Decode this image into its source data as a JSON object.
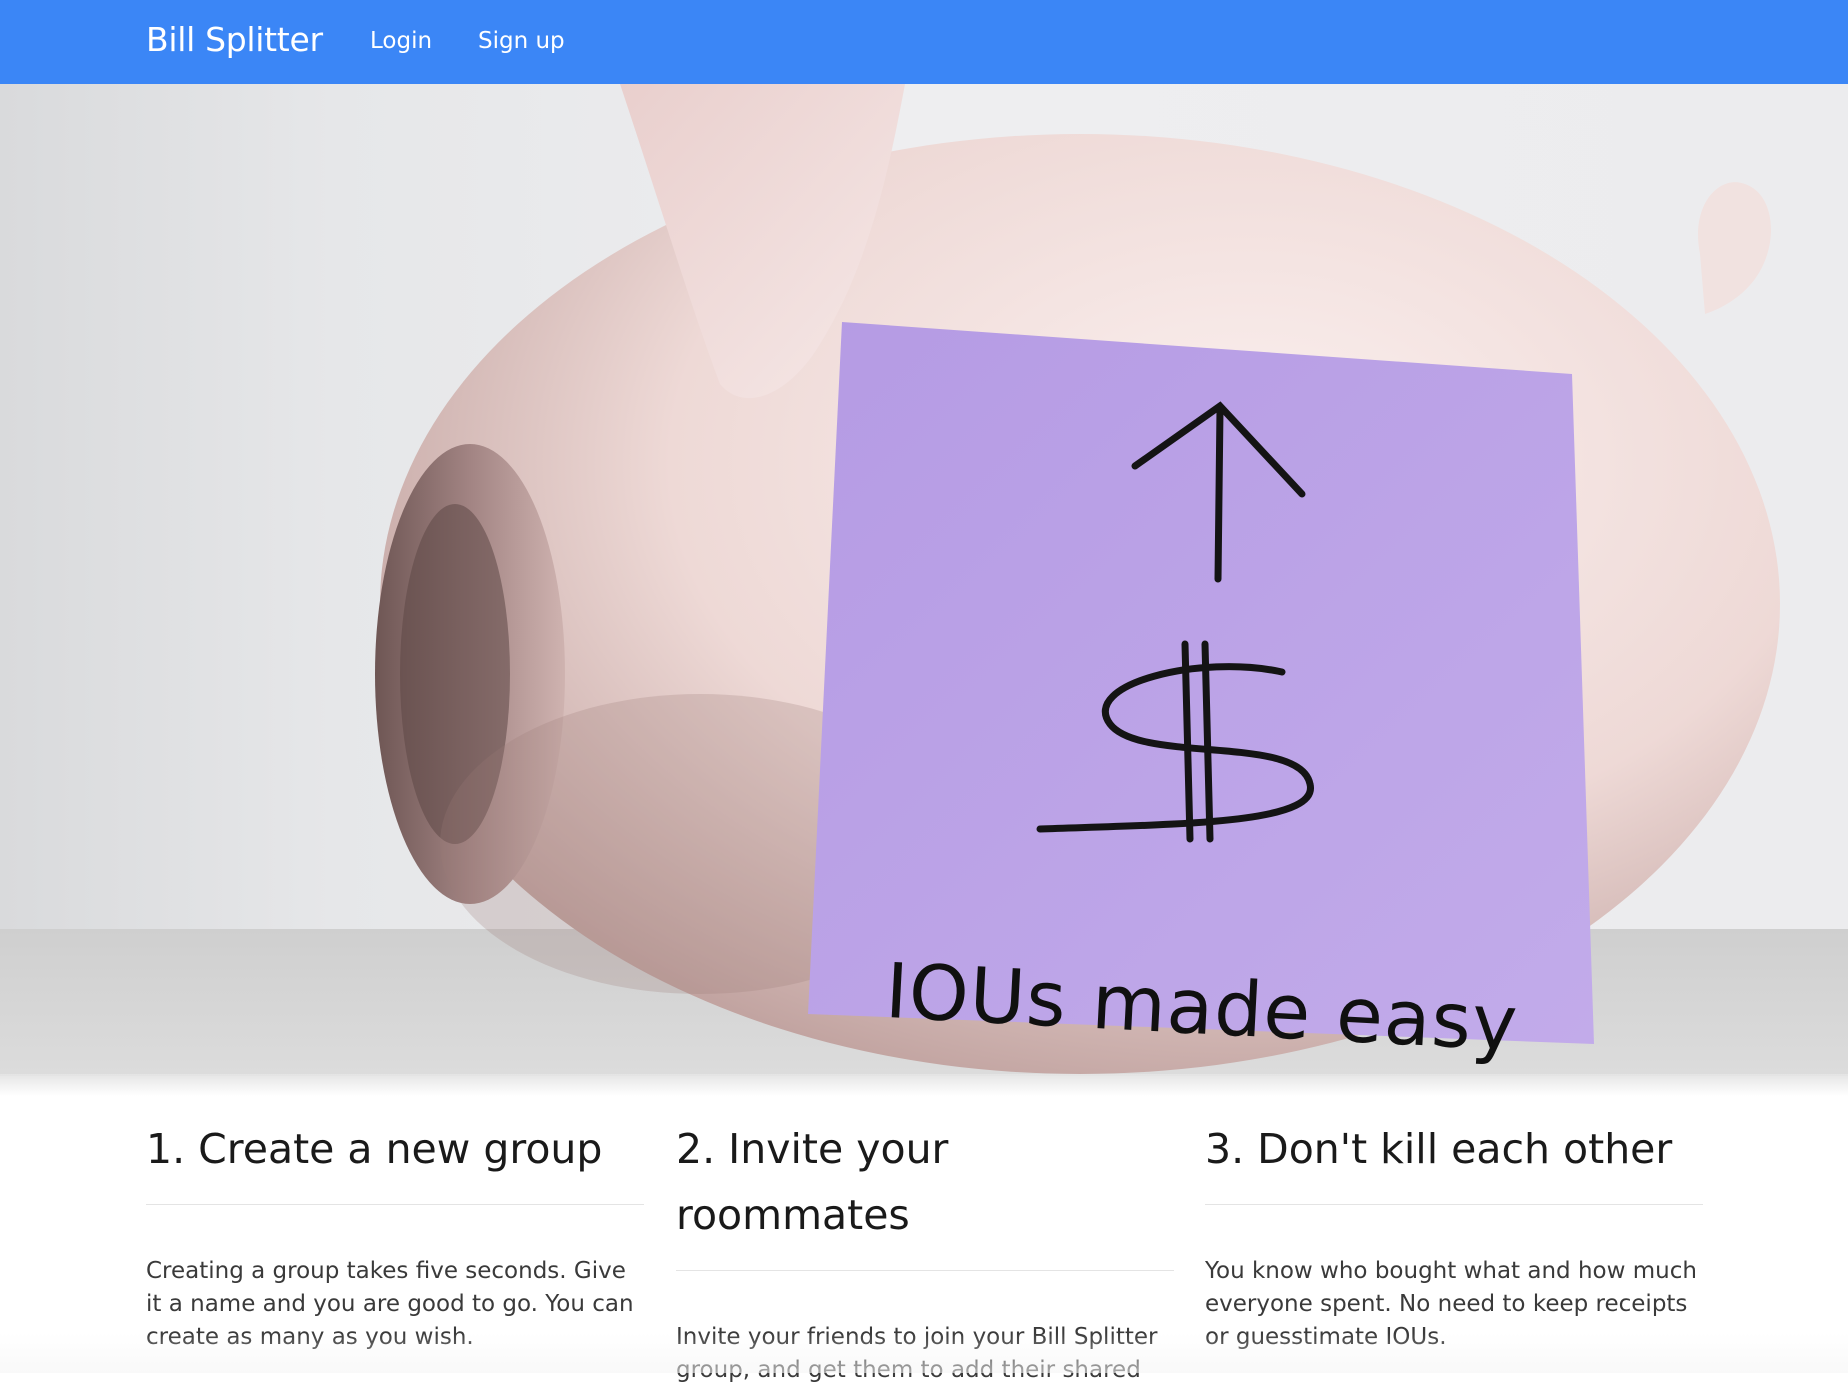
{
  "navbar": {
    "brand": "Bill Splitter",
    "links": [
      {
        "label": "Login"
      },
      {
        "label": "Sign up"
      }
    ],
    "color": "#3b86f6"
  },
  "hero": {
    "tagline": "IOUs made easy",
    "note_color": "#b79ae6",
    "pig_color": "#f2e1de"
  },
  "features": [
    {
      "title": "1. Create a new group",
      "text": "Creating a group takes five seconds. Give it a name and you are good to go. You can create as many as you wish."
    },
    {
      "title": "2. Invite your roommates",
      "text": "Invite your friends to join your Bill Splitter group, and get them to add their shared"
    },
    {
      "title": "3. Don't kill each other",
      "text": "You know who bought what and how much everyone spent. No need to keep receipts or guesstimate IOUs."
    }
  ]
}
